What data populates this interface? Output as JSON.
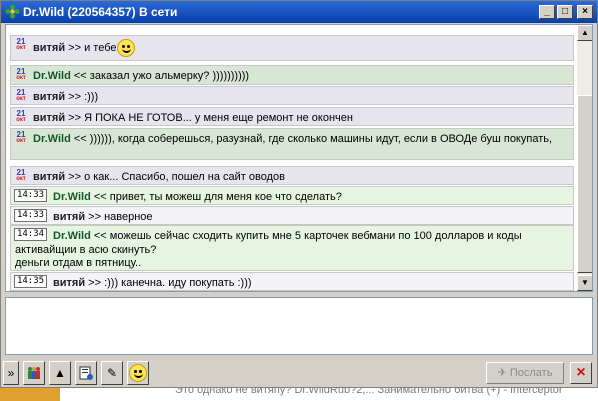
{
  "window": {
    "title": "Dr.Wild (220564357) В сети",
    "controls": {
      "minimize": "_",
      "maximize": "□",
      "close": "×"
    }
  },
  "messages": [
    {
      "stamp_day": "21",
      "stamp_month": "окт",
      "nick": "витяй",
      "arrow": ">>",
      "text": "и тебе",
      "emoticon": "smiley-icon",
      "kind": "local"
    },
    {
      "stamp_day": "21",
      "stamp_month": "окт",
      "nick": "Dr.Wild",
      "arrow": "<<",
      "text": "заказал ужо альмерку? ))))))))))",
      "kind": "remote"
    },
    {
      "stamp_day": "21",
      "stamp_month": "окт",
      "nick": "витяй",
      "arrow": ">>",
      "text": ":)))",
      "kind": "local"
    },
    {
      "stamp_day": "21",
      "stamp_month": "окт",
      "nick": "витяй",
      "arrow": ">>",
      "text": "Я ПОКА НЕ ГОТОВ... у меня еще ремонт не окончен",
      "kind": "local"
    },
    {
      "stamp_day": "21",
      "stamp_month": "окт",
      "nick": "Dr.Wild",
      "arrow": "<<",
      "text": ")))))), когда соберешься, разузнай, где сколько машины идут, если в ОВОДе буш покупать,",
      "kind": "remote"
    },
    {
      "stamp_day": "21",
      "stamp_month": "окт",
      "nick": "витяй",
      "arrow": ">>",
      "text": "о как... Спасибо, пошел на сайт оводов",
      "kind": "local"
    },
    {
      "time": "14:33",
      "nick": "Dr.Wild",
      "arrow": "<<",
      "text": "привет, ты можеш для меня кое что сделать?",
      "kind": "remote-new"
    },
    {
      "time": "14:33",
      "nick": "витяй",
      "arrow": ">>",
      "text": "наверное",
      "kind": "local-new"
    },
    {
      "time": "14:34",
      "nick": "Dr.Wild",
      "arrow": "<<",
      "text": "можешь сейчас сходить купить мне 5 карточек вебмани по 100 долларов и коды",
      "text2": "активайщии в асю скинуть?",
      "text3": "деньги отдам в пятницу..",
      "kind": "remote-new"
    },
    {
      "time": "14:35",
      "nick": "витяй",
      "arrow": ">>",
      "text": ":))) канечна. иду покупать :)))",
      "kind": "local-new"
    }
  ],
  "input": {
    "value": ""
  },
  "toolbar": {
    "tools": [
      "chevron-down-icon",
      "users-icon",
      "arrow-up-icon",
      "info-icon",
      "edit-icon",
      "smiley-icon"
    ],
    "send_label": "Послать",
    "close_label": "×"
  },
  "background": {
    "text": "Это однако не витяпу?     Dr.WildRub?2,...      Занимательно битва (+) - Interceptor"
  }
}
